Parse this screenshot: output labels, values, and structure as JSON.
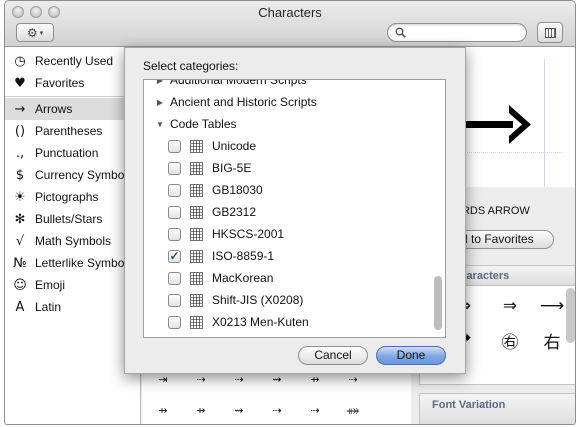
{
  "window": {
    "title": "Characters"
  },
  "toolbar": {
    "gear_icon": "⚙",
    "caret": "▾"
  },
  "sidebar": {
    "items": [
      {
        "icon": "◷",
        "label": "Recently Used",
        "icon_name": "clock-icon"
      },
      {
        "icon": "♥",
        "label": "Favorites",
        "icon_name": "heart-icon"
      },
      {
        "icon": "→",
        "label": "Arrows",
        "icon_name": "arrow-icon"
      },
      {
        "icon": "()",
        "label": "Parentheses",
        "icon_name": "parentheses-icon"
      },
      {
        "icon": ".,",
        "label": "Punctuation",
        "icon_name": "punctuation-icon"
      },
      {
        "icon": "$",
        "label": "Currency Symbols",
        "icon_name": "dollar-icon"
      },
      {
        "icon": "☀",
        "label": "Pictographs",
        "icon_name": "pictograph-icon"
      },
      {
        "icon": "✻",
        "label": "Bullets/Stars",
        "icon_name": "star-icon"
      },
      {
        "icon": "√",
        "label": "Math Symbols",
        "icon_name": "sqrt-icon"
      },
      {
        "icon": "№",
        "label": "Letterlike Symbols",
        "icon_name": "numero-icon"
      },
      {
        "icon": "☺",
        "label": "Emoji",
        "icon_name": "smiley-icon"
      },
      {
        "icon": "A",
        "label": "Latin",
        "icon_name": "latin-letter-icon"
      }
    ]
  },
  "grid": {
    "row1": [
      "⇥",
      "⇢",
      "⇢",
      "⇝",
      "⇸",
      "⇢"
    ],
    "row2": [
      "⇸",
      "⇸",
      "⇝",
      "⇢",
      "⇢",
      "⤁"
    ]
  },
  "preview": {
    "character_name": "RIGHTWARDS ARROW",
    "name_visible": "HTWARDS ARROW",
    "add_favorites_label": "Add to Favorites",
    "add_favorites_visible": "dd to Favorites"
  },
  "related": {
    "header": "Related Characters",
    "header_visible": "d Characters",
    "row1": [
      "⇏",
      "⇒",
      "⟶"
    ],
    "row2": [
      "➡",
      "㊨",
      "右"
    ]
  },
  "font_variation": {
    "label": "Font Variation"
  },
  "sheet": {
    "title": "Select categories:",
    "disclosure_rows": [
      {
        "triangle": "▶",
        "label": "Additional Modern Scripts"
      },
      {
        "triangle": "▶",
        "label": "Ancient and Historic Scripts"
      },
      {
        "triangle": "▼",
        "label": "Code Tables"
      }
    ],
    "code_tables": [
      {
        "label": "Unicode",
        "checked": false
      },
      {
        "label": "BIG-5E",
        "checked": false
      },
      {
        "label": "GB18030",
        "checked": false
      },
      {
        "label": "GB2312",
        "checked": false
      },
      {
        "label": "HKSCS-2001",
        "checked": false
      },
      {
        "label": "ISO-8859-1",
        "checked": true
      },
      {
        "label": "MacKorean",
        "checked": false
      },
      {
        "label": "Shift-JIS (X0208)",
        "checked": false
      },
      {
        "label": "X0213 Men-Kuten",
        "checked": false
      }
    ],
    "check_mark": "✓",
    "cancel_label": "Cancel",
    "done_label": "Done"
  },
  "colors": {
    "done_button": "#6b97dc",
    "section_header_text": "#5a6a84",
    "selection": "#dcdcdc"
  }
}
